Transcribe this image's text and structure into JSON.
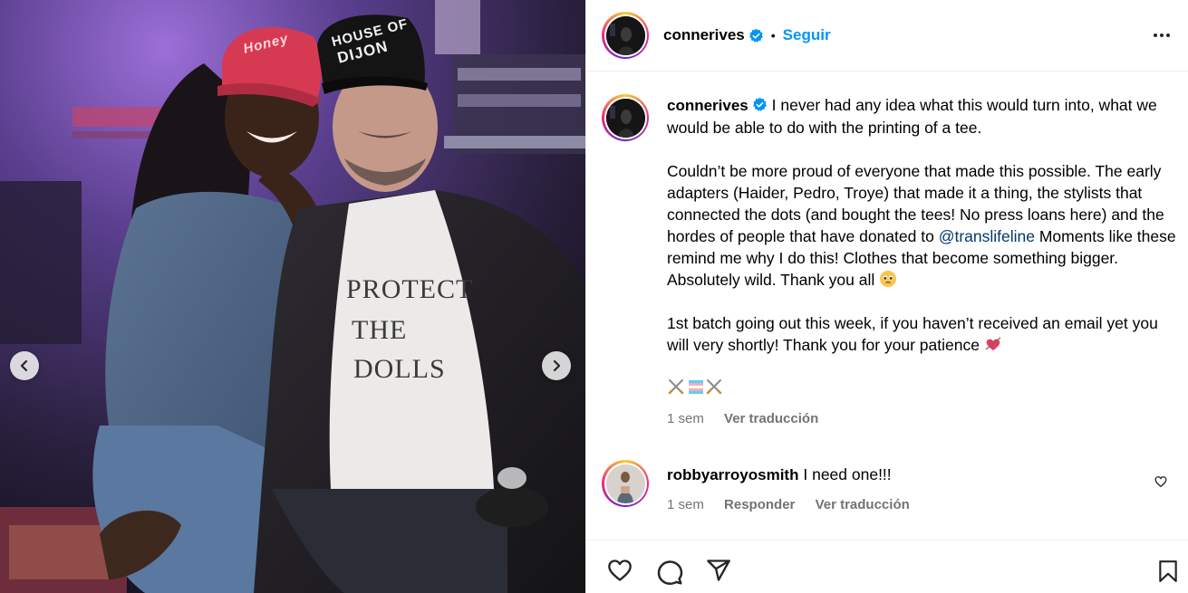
{
  "post": {
    "username": "connerives",
    "follow_label": "Seguir",
    "separator": "•",
    "photo": {
      "shirt_lines": [
        "PROTECT",
        "THE",
        "DOLLS"
      ],
      "cap_lines": [
        "HOUSE OF",
        "DIJON"
      ],
      "red_cap_text": "Honey"
    }
  },
  "caption": {
    "username": "connerives",
    "line1": "I never had any idea what this would turn into, what we would be able to do with the printing of a tee.",
    "para2_before": "Couldn’t be more proud of everyone that made this possible. The early adapters (Haider, Pedro, Troye) that made it a thing, the stylists that connected the dots (and bought the tees! No press loans here) and the hordes of people that have donated to ",
    "mention": "@translifeline",
    "para2_after": " Moments like these remind me why I do this! Clothes that become something bigger. Absolutely wild. Thank you all ",
    "para3": "1st batch going out this week, if you haven’t received an email yet you will very shortly! Thank you for your patience ",
    "time": "1 sem",
    "translate": "Ver traducción"
  },
  "comment": {
    "username": "robbyarroyosmith",
    "text": "I need one!!!",
    "time": "1 sem",
    "reply": "Responder",
    "translate": "Ver traducción"
  },
  "icons": {
    "verified": "verified-badge-icon",
    "more": "more-options-icon",
    "prev": "chevron-left-icon",
    "next": "chevron-right-icon",
    "like": "heart-icon",
    "comment": "comment-icon",
    "share": "share-icon",
    "save": "bookmark-icon"
  },
  "colors": {
    "accent": "#0095f6",
    "mention": "#00376b",
    "secondary_text": "#737373"
  }
}
